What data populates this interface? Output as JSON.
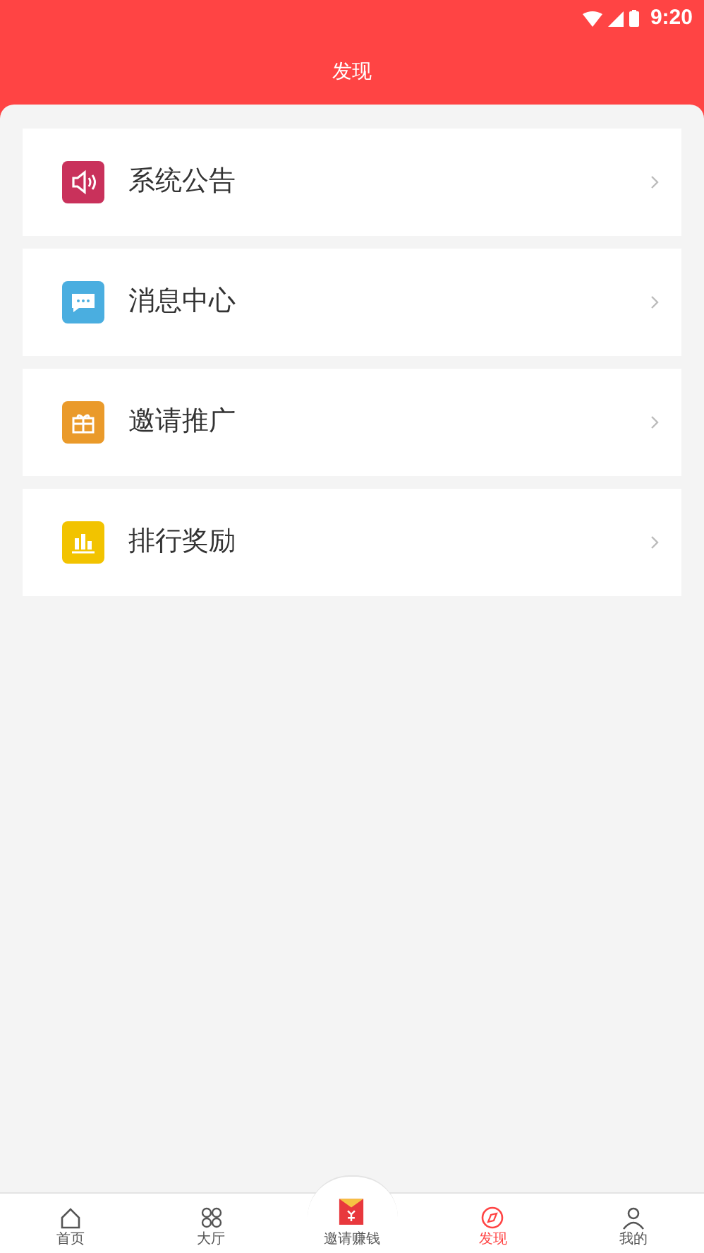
{
  "status_bar": {
    "time": "9:20"
  },
  "header": {
    "title": "发现"
  },
  "menu": [
    {
      "label": "系统公告",
      "kind": "speaker",
      "color": "#c9315b"
    },
    {
      "label": "消息中心",
      "kind": "chat",
      "color": "#4aaee0"
    },
    {
      "label": "邀请推广",
      "kind": "gift",
      "color": "#ea9a2a"
    },
    {
      "label": "排行奖励",
      "kind": "chart",
      "color": "#f2c300"
    }
  ],
  "tab_bar": [
    {
      "label": "首页",
      "kind": "home",
      "selected": false
    },
    {
      "label": "大厅",
      "kind": "grid",
      "selected": false
    },
    {
      "label": "邀请赚钱",
      "kind": "envelope",
      "selected": false
    },
    {
      "label": "发现",
      "kind": "compass",
      "selected": true
    },
    {
      "label": "我的",
      "kind": "person",
      "selected": false
    }
  ]
}
